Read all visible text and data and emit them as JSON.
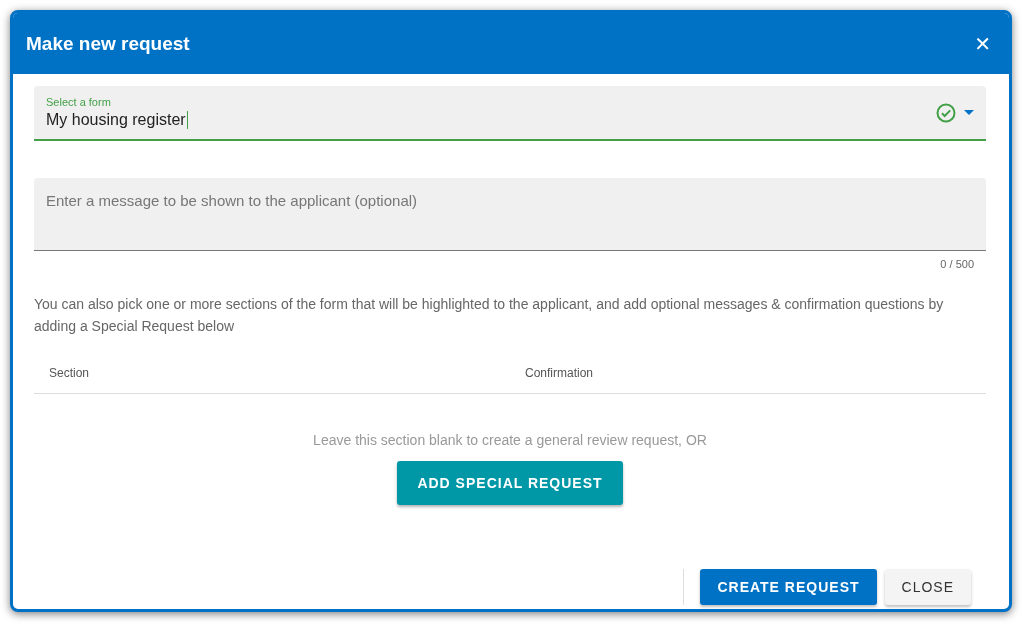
{
  "dialog": {
    "title": "Make new request",
    "close_label": "✕"
  },
  "form_select": {
    "label": "Select a form",
    "value": "My housing register",
    "valid": true
  },
  "message_field": {
    "placeholder": "Enter a message to be shown to the applicant (optional)",
    "counter": "0 / 500"
  },
  "info_text": "You can also pick one or more sections of the form that will be highlighted to the applicant, and add optional messages & confirmation questions by adding a Special Request below",
  "table": {
    "columns": [
      "Section",
      "Confirmation"
    ]
  },
  "hint": "Leave this section blank to create a general review request, OR",
  "add_button": "ADD SPECIAL REQUEST",
  "footer_buttons": [
    {
      "label": "CREATE REQUEST",
      "kind": "primary"
    },
    {
      "label": "CLOSE",
      "kind": "secondary"
    }
  ]
}
